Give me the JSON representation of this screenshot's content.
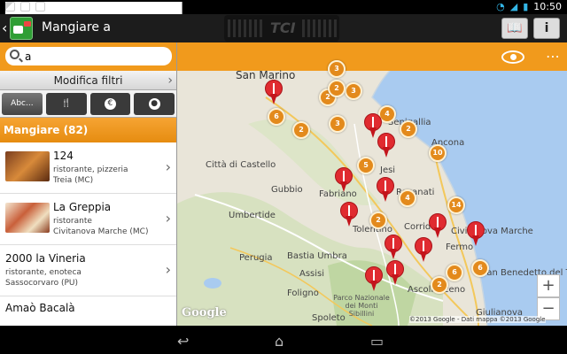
{
  "status": {
    "time": "10:50"
  },
  "actionbar": {
    "title": "Mangiare a",
    "center_logo": "TCI",
    "btn_guide": "📖",
    "btn_info": "i"
  },
  "search": {
    "value": "a",
    "placeholder": ""
  },
  "filters_label": "Modifica filtri",
  "filter_buttons": [
    "Abc...",
    "🍴",
    "€",
    "●"
  ],
  "section": {
    "title": "Mangiare (82)"
  },
  "results": [
    {
      "name": "124",
      "type": "ristorante, pizzeria",
      "place": "Treia (MC)"
    },
    {
      "name": "La Greppia",
      "type": "ristorante",
      "place": "Civitanova Marche (MC)"
    },
    {
      "name": "2000 la Vineria",
      "type": "ristorante, enoteca",
      "place": "Sassocorvaro (PU)"
    },
    {
      "name": "Amaò Bacalà",
      "type": "",
      "place": ""
    }
  ],
  "map": {
    "towns": [
      "San Marino",
      "Città di Castello",
      "Gubbio",
      "Umbertide",
      "Perugia",
      "Bastia Umbra",
      "Assisi",
      "Foligno",
      "Spoleto",
      "Fabriano",
      "Jesi",
      "Recanati",
      "Ancona",
      "Civitanova Marche",
      "Fermo",
      "Tolentino",
      "Ascoli Piceno",
      "San Benedetto del Tronto",
      "Giulianova",
      "Corrido",
      "Senigallia"
    ],
    "park_label": "Parco Nazionale dei Monti Sibillini",
    "clusters": [
      "3",
      "2",
      "3",
      "6",
      "2",
      "3",
      "4",
      "2",
      "5",
      "10",
      "4",
      "2",
      "6",
      "2",
      "14",
      "6",
      "2"
    ],
    "google": "Google",
    "attribution": "©2013 Google - Dati mappa ©2013 Google",
    "zoom_in": "+",
    "zoom_out": "−"
  },
  "nav": {
    "back": "↩",
    "home": "⌂",
    "recent": "▭"
  },
  "colors": {
    "orange": "#f19a1c",
    "pin": "#e02b30",
    "cluster": "#e38a1c"
  }
}
